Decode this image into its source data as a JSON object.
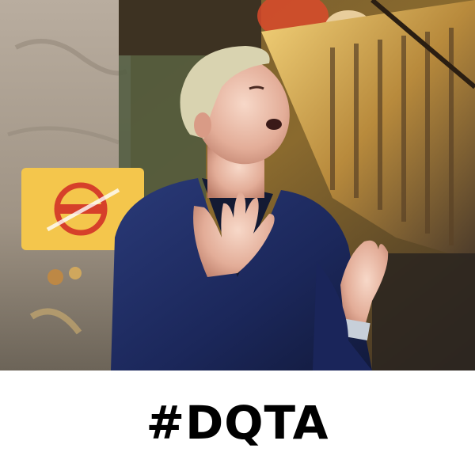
{
  "caption": {
    "text": "#DQTA"
  },
  "photo": {
    "colors": {
      "wall": "#b8aa9a",
      "warm_light": "#f2c25a",
      "jacket": "#1d2a5c",
      "skin": "#e9b9a8",
      "hair": "#d9d3b0",
      "sign": "#f4c64c",
      "sign_stamp": "#d6402a"
    }
  }
}
